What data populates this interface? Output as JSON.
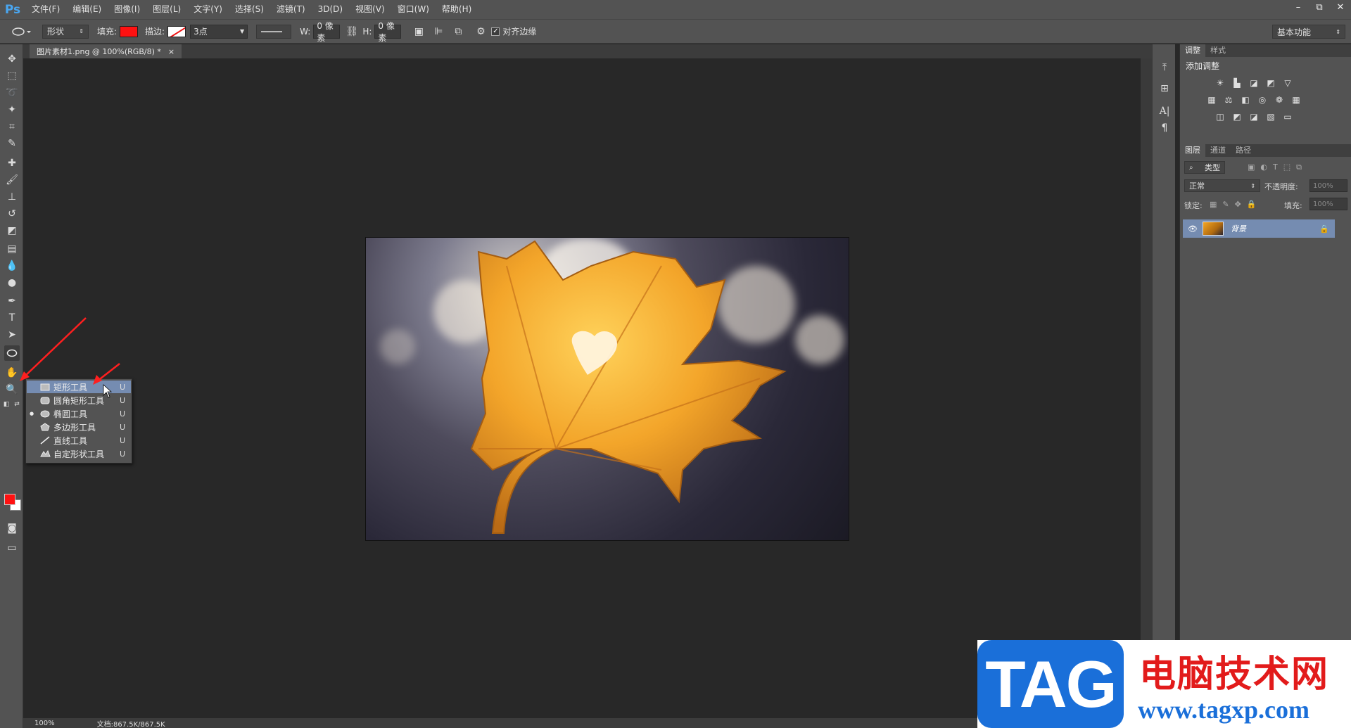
{
  "app": {
    "logo": "Ps",
    "menus": [
      "文件(F)",
      "编辑(E)",
      "图像(I)",
      "图层(L)",
      "文字(Y)",
      "选择(S)",
      "滤镜(T)",
      "3D(D)",
      "视图(V)",
      "窗口(W)",
      "帮助(H)"
    ],
    "window_controls": {
      "minimize": "–",
      "restore": "⧉",
      "close": "✕"
    }
  },
  "options": {
    "tool_mode": "形状",
    "fill_label": "填充:",
    "stroke_label": "描边:",
    "stroke_width": "3点",
    "w_label": "W:",
    "w_value": "0 像素",
    "h_label": "H:",
    "h_value": "0 像素",
    "align_edges_label": "对齐边缘",
    "workspace": "基本功能",
    "fill_color": "#ff1111"
  },
  "document": {
    "tab_title": "图片素材1.png @ 100%(RGB/8) *",
    "tab_close": "×"
  },
  "flyout": {
    "items": [
      {
        "label": "矩形工具",
        "key": "U",
        "icon": "rectangle-icon",
        "hover": true,
        "selected": false
      },
      {
        "label": "圆角矩形工具",
        "key": "U",
        "icon": "rounded-rectangle-icon",
        "hover": false,
        "selected": false
      },
      {
        "label": "椭圆工具",
        "key": "U",
        "icon": "ellipse-icon",
        "hover": false,
        "selected": true
      },
      {
        "label": "多边形工具",
        "key": "U",
        "icon": "polygon-icon",
        "hover": false,
        "selected": false
      },
      {
        "label": "直线工具",
        "key": "U",
        "icon": "line-icon",
        "hover": false,
        "selected": false
      },
      {
        "label": "自定形状工具",
        "key": "U",
        "icon": "custom-shape-icon",
        "hover": false,
        "selected": false
      }
    ]
  },
  "panels": {
    "adjust_tabs": [
      "调整",
      "样式"
    ],
    "adjust_title": "添加调整",
    "layers_tabs": [
      "图层",
      "通道",
      "路径"
    ],
    "filter_kind": "类型",
    "blend_mode": "正常",
    "opacity_label": "不透明度:",
    "opacity_value": "100%",
    "lock_label": "锁定:",
    "fill_label": "填充:",
    "fill_value": "100%",
    "layer_name": "背景"
  },
  "status": {
    "zoom": "100%",
    "doc_size": "文档:867.5K/867.5K"
  },
  "watermark": {
    "tag": "TAG",
    "site_name": "电脑技术网",
    "url": "www.tagxp.com"
  }
}
